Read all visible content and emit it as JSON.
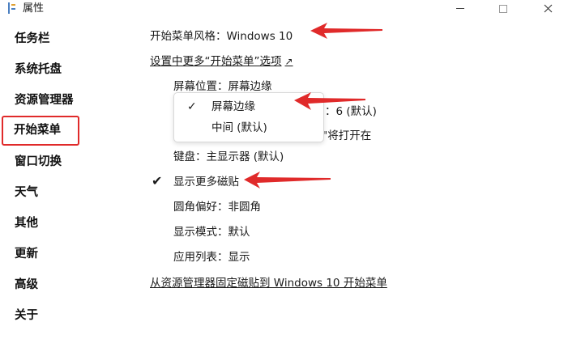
{
  "window": {
    "title": "属性"
  },
  "sidebar": {
    "items": [
      {
        "label": "任务栏"
      },
      {
        "label": "系统托盘"
      },
      {
        "label": "资源管理器"
      },
      {
        "label": "开始菜单",
        "active": true
      },
      {
        "label": "窗口切换"
      },
      {
        "label": "天气"
      },
      {
        "label": "其他"
      },
      {
        "label": "更新"
      },
      {
        "label": "高级"
      },
      {
        "label": "关于"
      }
    ]
  },
  "main": {
    "start_menu_style": "开始菜单风格：Windows 10",
    "more_options_link": "设置中更多“开始菜单”选项",
    "more_options_arrow": "↗",
    "screen_position": "屏幕位置：屏幕边缘",
    "partial_right_1": "：6 (默认)",
    "partial_right_2": "\"将打开在",
    "keyboard": "键盘：主显示器 (默认)",
    "show_more_tiles": "显示更多磁贴",
    "show_more_tiles_checked": true,
    "corner_pref": "圆角偏好：非圆角",
    "display_mode": "显示模式：默认",
    "app_list": "应用列表：显示",
    "pin_tiles_link": "从资源管理器固定磁贴到 Windows 10 开始菜单"
  },
  "dropdown": {
    "options": [
      {
        "label": "屏幕边缘",
        "selected": true
      },
      {
        "label": "中间 (默认)",
        "selected": false
      }
    ]
  },
  "colors": {
    "annotation": "#e02a2a",
    "active_outline": "#e02a2a"
  },
  "icons": {
    "app": "app-icon",
    "minimize": "minimize-icon",
    "maximize": "maximize-icon",
    "close": "close-icon",
    "external": "external-link-icon",
    "check": "checkmark-icon"
  }
}
